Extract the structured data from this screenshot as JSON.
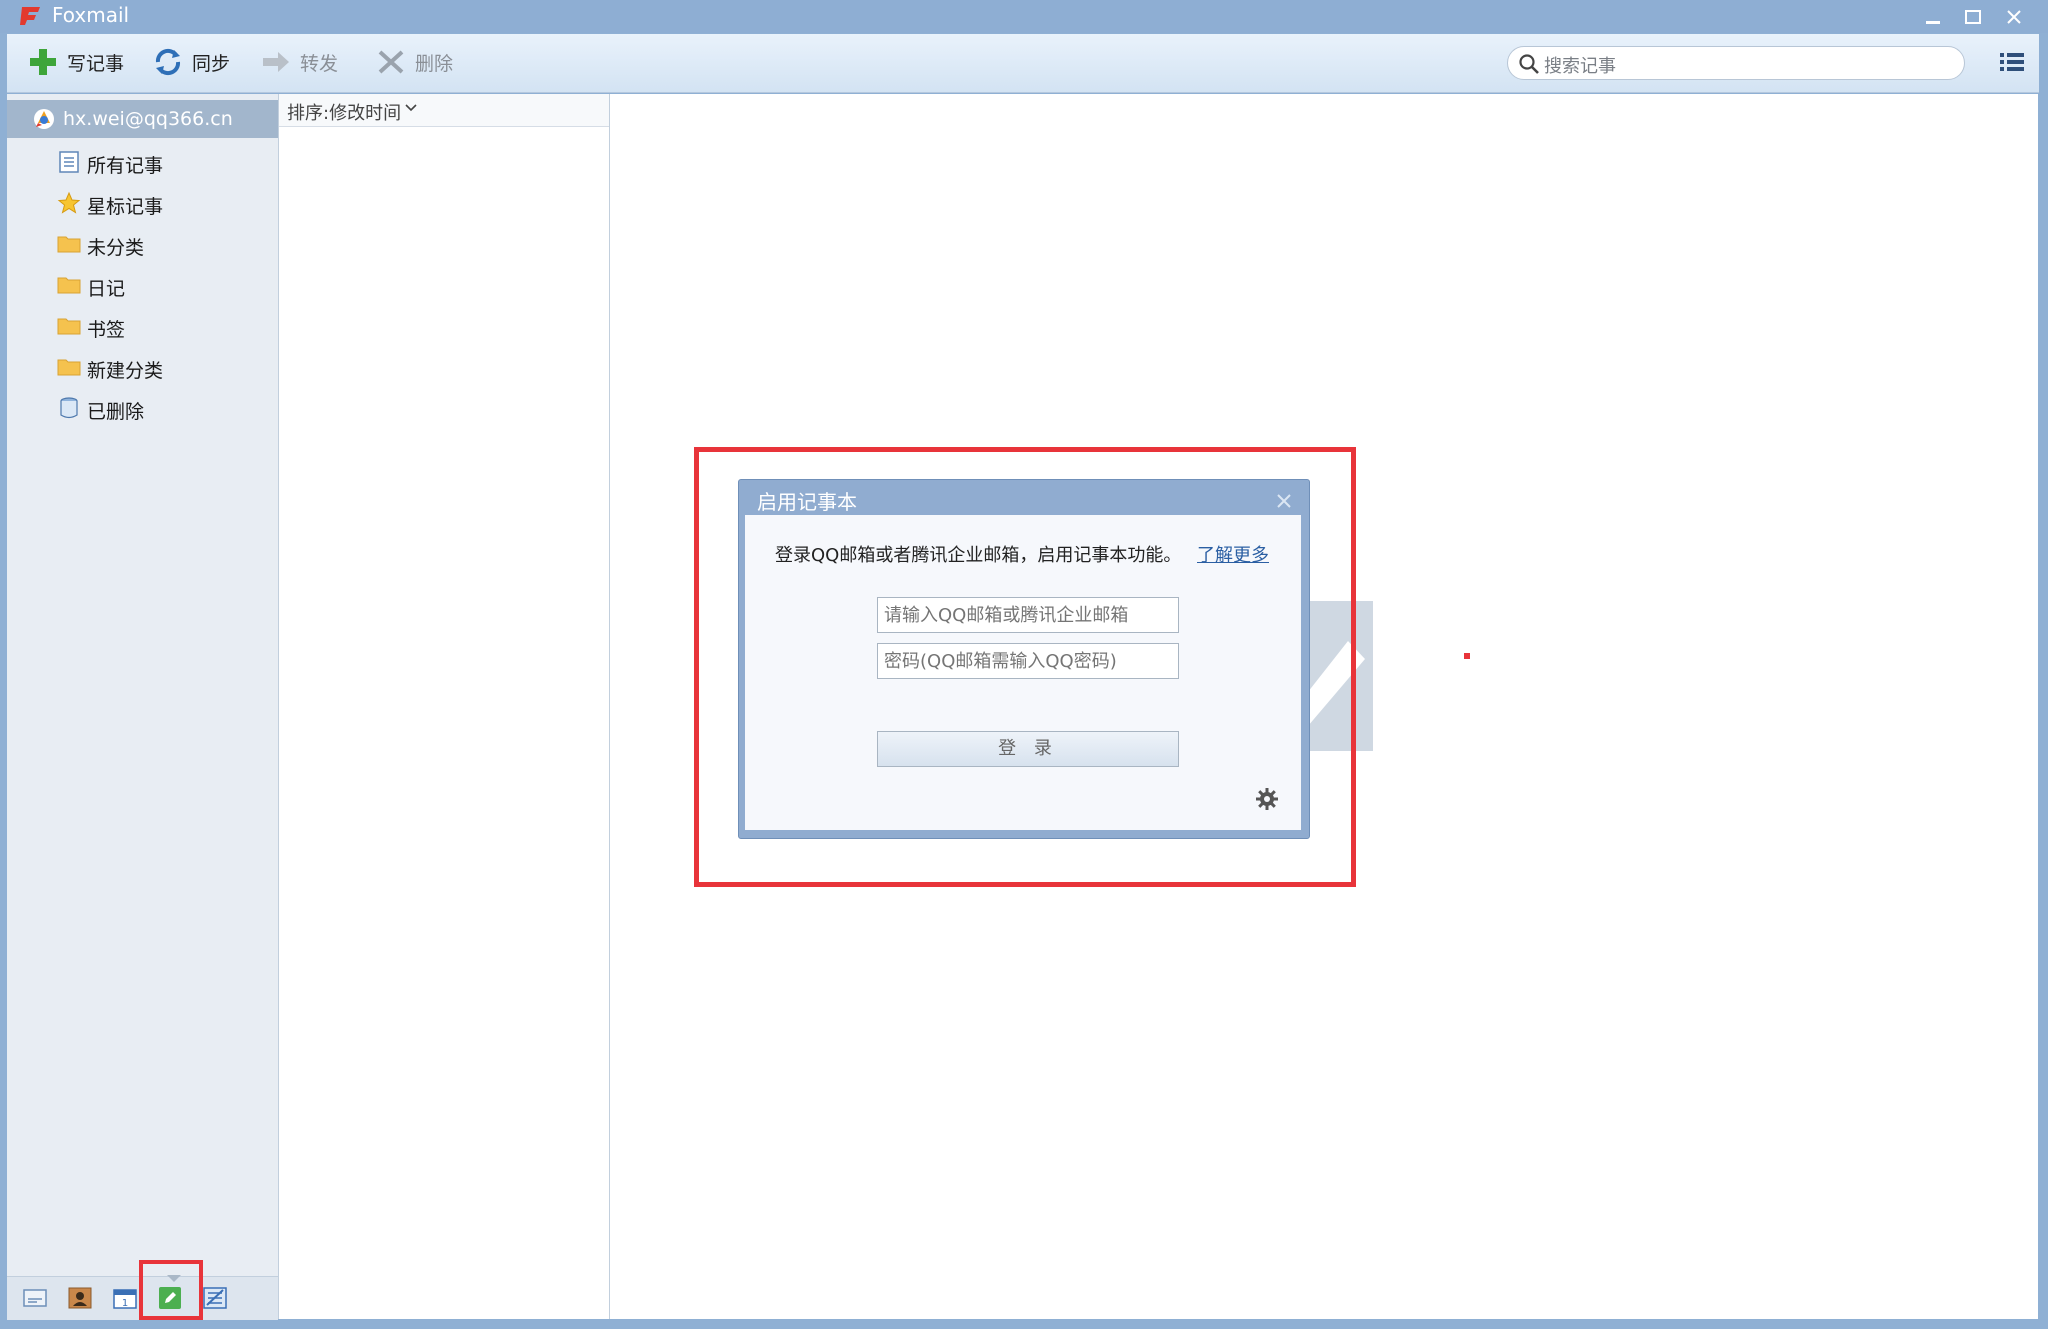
{
  "window": {
    "title": "Foxmail"
  },
  "toolbar": {
    "compose_label": "写记事",
    "sync_label": "同步",
    "forward_label": "转发",
    "delete_label": "删除",
    "search_placeholder": "搜索记事"
  },
  "sidebar": {
    "account": "hx.wei@qq366.cn",
    "items": [
      {
        "label": "所有记事",
        "icon": "notes-list-icon"
      },
      {
        "label": "星标记事",
        "icon": "star-icon"
      },
      {
        "label": "未分类",
        "icon": "folder-icon"
      },
      {
        "label": "日记",
        "icon": "folder-icon"
      },
      {
        "label": "书签",
        "icon": "folder-icon"
      },
      {
        "label": "新建分类",
        "icon": "folder-icon"
      },
      {
        "label": "已删除",
        "icon": "trash-icon"
      }
    ],
    "bottom_icons": [
      "mail-icon",
      "contacts-icon",
      "calendar-icon",
      "notes-icon",
      "tasks-icon"
    ]
  },
  "list": {
    "sort_label": "排序:修改时间"
  },
  "dialog": {
    "title": "启用记事本",
    "message": "登录QQ邮箱或者腾讯企业邮箱，启用记事本功能。",
    "learn_more": "了解更多",
    "email_placeholder": "请输入QQ邮箱或腾讯企业邮箱",
    "password_placeholder": "密码(QQ邮箱需输入QQ密码)",
    "login_label": "登 录"
  },
  "colors": {
    "highlight_frame": "#e8343a",
    "title_bar": "#8eaed3",
    "account_bg": "#a2b6cc"
  }
}
